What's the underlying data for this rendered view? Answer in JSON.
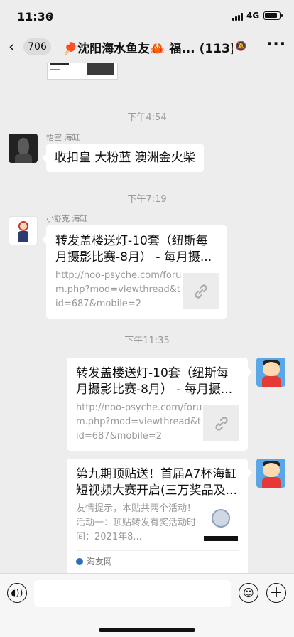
{
  "status_bar": {
    "time": "11:36",
    "location_icon": "location-arrow-icon",
    "network": "4G"
  },
  "nav": {
    "back_icon": "chevron-left-icon",
    "unread_count": "706",
    "title": "🏓沈阳海水鱼友🦀 福...",
    "member_count": "(113)",
    "mute_icon": "bell-slash-icon",
    "more_icon": "ellipsis-icon"
  },
  "messages": {
    "ts1": "下午4:54",
    "m1": {
      "sender": "悟空 海缸",
      "text": "收扣皇 大粉蓝 澳洲金火柴"
    },
    "ts2": "下午7:19",
    "m2": {
      "sender": "小舒克 海缸",
      "title": "转发盖楼送灯-10套（纽斯每月摄影比赛-8月） - 每月摄...",
      "desc": "http://noo-psyche.com/forum.php?mod=viewthread&tid=687&mobile=2",
      "icon": "link-icon"
    },
    "ts3": "下午11:35",
    "m3": {
      "title": "转发盖楼送灯-10套（纽斯每月摄影比赛-8月） - 每月摄...",
      "desc": "http://noo-psyche.com/forum.php?mod=viewthread&tid=687&mobile=2",
      "icon": "link-icon"
    },
    "m4": {
      "title": "第九期顶贴送！首届A7杯海缸短视频大赛开启(三万奖品及...",
      "desc": "友情提示，本贴共两个活动！活动一：顶贴转发有奖活动时间：2021年8...",
      "source": "海友网"
    }
  },
  "input_bar": {
    "voice_icon": "voice-icon",
    "emoji_icon": "emoji-icon",
    "plus_icon": "plus-icon"
  }
}
